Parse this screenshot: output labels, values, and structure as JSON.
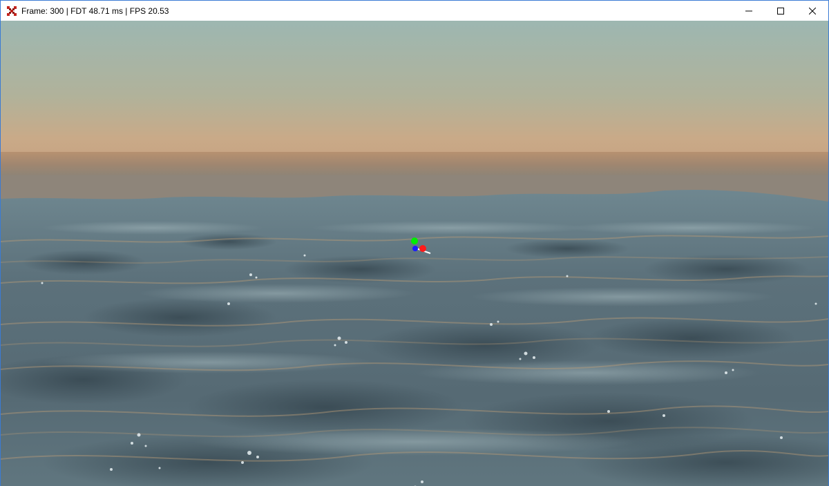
{
  "window": {
    "title": "Frame: 300 | FDT 48.71 ms | FPS 20.53",
    "app_icon": "grid-logo-icon",
    "controls": [
      "minimize-icon",
      "maximize-icon",
      "close-icon"
    ]
  },
  "scene": {
    "sky_colors": [
      "#9fb7b0",
      "#a9b5a1",
      "#c7a98a",
      "#b38c6c"
    ],
    "water_colors": [
      "#5b7078",
      "#4a5e68",
      "#6f8b96",
      "#8fa6ad"
    ],
    "gizmo": {
      "axes": [
        "x-axis-red",
        "y-axis-green",
        "z-axis-blue"
      ],
      "colors": {
        "x": "#ff1a1a",
        "y": "#00ee00",
        "z": "#1a1aff"
      }
    }
  }
}
